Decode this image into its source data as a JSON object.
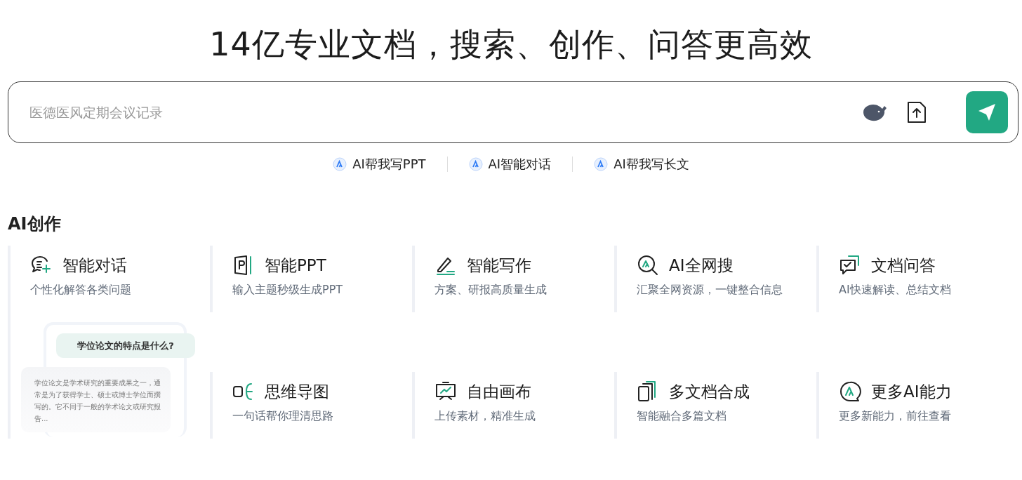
{
  "headline": "14亿专业文档，搜索、创作、问答更高效",
  "search": {
    "placeholder": "医德医风定期会议记录"
  },
  "quick_links": [
    {
      "label": "AI帮我写PPT"
    },
    {
      "label": "AI智能对话"
    },
    {
      "label": "AI帮我写长文"
    }
  ],
  "section_title": "AI创作",
  "features": [
    {
      "kind": "chat",
      "title": "智能对话",
      "subtitle": "个性化解答各类问题",
      "preview": {
        "question": "学位论文的特点是什么?",
        "answer": "学位论文是学术研究的重要成果之一，通常是为了获得学士、硕士或博士学位而撰写的。它不同于一般的学术论文或研究报告..."
      }
    },
    {
      "kind": "ppt",
      "title": "智能PPT",
      "subtitle": "输入主题秒级生成PPT"
    },
    {
      "kind": "write",
      "title": "智能写作",
      "subtitle": "方案、研报高质量生成"
    },
    {
      "kind": "search",
      "title": "AI全网搜",
      "subtitle": "汇聚全网资源，一键整合信息"
    },
    {
      "kind": "qa",
      "title": "文档问答",
      "subtitle": "AI快速解读、总结文档"
    },
    {
      "kind": "mindmap",
      "title": "思维导图",
      "subtitle": "一句话帮你理清思路"
    },
    {
      "kind": "canvas",
      "title": "自由画布",
      "subtitle": "上传素材，精准生成"
    },
    {
      "kind": "merge",
      "title": "多文档合成",
      "subtitle": "智能融合多篇文档"
    },
    {
      "kind": "more",
      "title": "更多AI能力",
      "subtitle": "更多新能力，前往查看"
    }
  ]
}
